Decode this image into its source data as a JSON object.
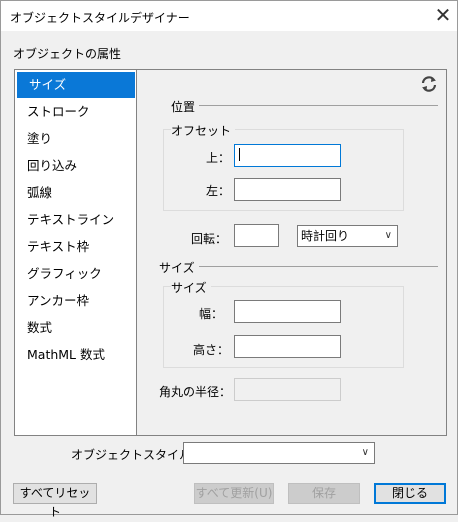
{
  "window": {
    "title": "オブジェクトスタイルデザイナー"
  },
  "section_label": "オブジェクトの属性",
  "sidebar": {
    "items": [
      {
        "label": "サイズ",
        "selected": true
      },
      {
        "label": "ストローク"
      },
      {
        "label": "塗り"
      },
      {
        "label": "回り込み"
      },
      {
        "label": "弧線"
      },
      {
        "label": "テキストライン"
      },
      {
        "label": "テキスト枠"
      },
      {
        "label": "グラフィック"
      },
      {
        "label": "アンカー枠"
      },
      {
        "label": "数式"
      },
      {
        "label": "MathML 数式"
      }
    ]
  },
  "panel": {
    "position": {
      "title": "位置",
      "offset": {
        "title": "オフセット",
        "top_label": "上：",
        "top_value": "",
        "left_label": "左：",
        "left_value": ""
      },
      "rotation_label": "回転：",
      "rotation_value": "",
      "direction": "時計回り"
    },
    "size": {
      "title": "サイズ",
      "group_title": "サイズ",
      "width_label": "幅：",
      "width_value": "",
      "height_label": "高さ：",
      "height_value": ""
    },
    "corner_radius_label": "角丸の半径：",
    "corner_radius_value": ""
  },
  "footer": {
    "object_style_label": "オブジェクトスタイル(O)：",
    "object_style_value": "",
    "reset_all": "すべてリセット",
    "update_all": "すべて更新(U)",
    "save": "保存",
    "close": "閉じる"
  },
  "colors": {
    "accent": "#0a78d7"
  }
}
